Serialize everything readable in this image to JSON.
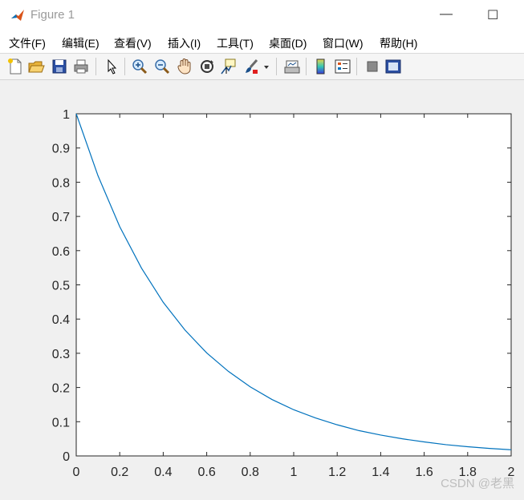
{
  "window": {
    "title": "Figure 1",
    "minimize_glyph": "—",
    "maximize_glyph": "☐"
  },
  "menu": {
    "items": [
      "文件(F)",
      "编辑(E)",
      "查看(V)",
      "插入(I)",
      "工具(T)",
      "桌面(D)",
      "窗口(W)",
      "帮助(H)"
    ]
  },
  "toolbar": {
    "icons": [
      "new-figure-icon",
      "open-file-icon",
      "save-icon",
      "print-icon",
      "pointer-icon",
      "zoom-in-icon",
      "zoom-out-icon",
      "pan-hand-icon",
      "rotate-3d-icon",
      "data-cursor-icon",
      "brush-icon",
      "brush-dropdown-icon",
      "link-plot-icon",
      "colorbar-icon",
      "legend-icon",
      "hide-plot-tools-icon",
      "show-plot-tools-icon"
    ]
  },
  "watermark": "CSDN @老黑",
  "colors": {
    "line": "#0072bd",
    "axes_bg": "#ffffff"
  },
  "chart_data": {
    "type": "line",
    "title": "",
    "xlabel": "",
    "ylabel": "",
    "xlim": [
      0,
      2
    ],
    "ylim": [
      0,
      1
    ],
    "xticks": [
      "0",
      "0.2",
      "0.4",
      "0.6",
      "0.8",
      "1",
      "1.2",
      "1.4",
      "1.6",
      "1.8",
      "2"
    ],
    "yticks": [
      "0",
      "0.1",
      "0.2",
      "0.3",
      "0.4",
      "0.5",
      "0.6",
      "0.7",
      "0.8",
      "0.9",
      "1"
    ],
    "grid": false,
    "x": [
      0,
      0.1,
      0.2,
      0.3,
      0.4,
      0.5,
      0.6,
      0.7,
      0.8,
      0.9,
      1.0,
      1.1,
      1.2,
      1.3,
      1.4,
      1.5,
      1.6,
      1.7,
      1.8,
      1.9,
      2.0
    ],
    "y": [
      1.0,
      0.819,
      0.67,
      0.549,
      0.449,
      0.368,
      0.301,
      0.247,
      0.202,
      0.165,
      0.135,
      0.111,
      0.091,
      0.074,
      0.061,
      0.05,
      0.041,
      0.033,
      0.027,
      0.022,
      0.018
    ]
  }
}
